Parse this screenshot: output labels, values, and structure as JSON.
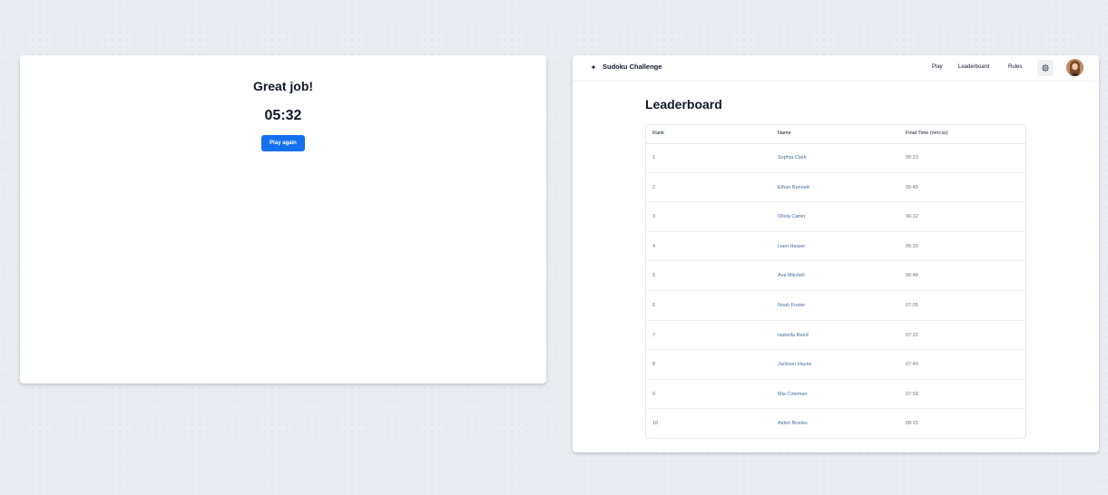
{
  "result": {
    "title": "Great job!",
    "time": "05:32",
    "play_again_label": "Play again"
  },
  "header": {
    "brand_icon": "sparkle-icon",
    "brand_title": "Sudoku Challenge",
    "nav": {
      "play": "Play",
      "leaderboard": "Leaderboard",
      "rules": "Rules"
    },
    "settings_icon": "gear-icon",
    "avatar": "user-avatar"
  },
  "leaderboard": {
    "heading": "Leaderboard",
    "columns": {
      "rank": "Rank",
      "name": "Name",
      "time": "Final Time (mm:ss)"
    },
    "rows": [
      {
        "rank": "1",
        "name": "Sophia Clark",
        "time": "05:23"
      },
      {
        "rank": "2",
        "name": "Ethan Bennett",
        "time": "05:45"
      },
      {
        "rank": "3",
        "name": "Olivia Carter",
        "time": "06:12"
      },
      {
        "rank": "4",
        "name": "Liam Harper",
        "time": "06:30"
      },
      {
        "rank": "5",
        "name": "Ava Mitchell",
        "time": "06:48"
      },
      {
        "rank": "6",
        "name": "Noah Foster",
        "time": "07:05"
      },
      {
        "rank": "7",
        "name": "Isabella Reed",
        "time": "07:22"
      },
      {
        "rank": "8",
        "name": "Jackson Hayes",
        "time": "07:40"
      },
      {
        "rank": "9",
        "name": "Mia Coleman",
        "time": "07:58"
      },
      {
        "rank": "10",
        "name": "Aiden Brooks",
        "time": "08:15"
      }
    ]
  },
  "colors": {
    "accent": "#1570ef",
    "background": "#e9ecf0",
    "link": "#4b6a9b"
  }
}
